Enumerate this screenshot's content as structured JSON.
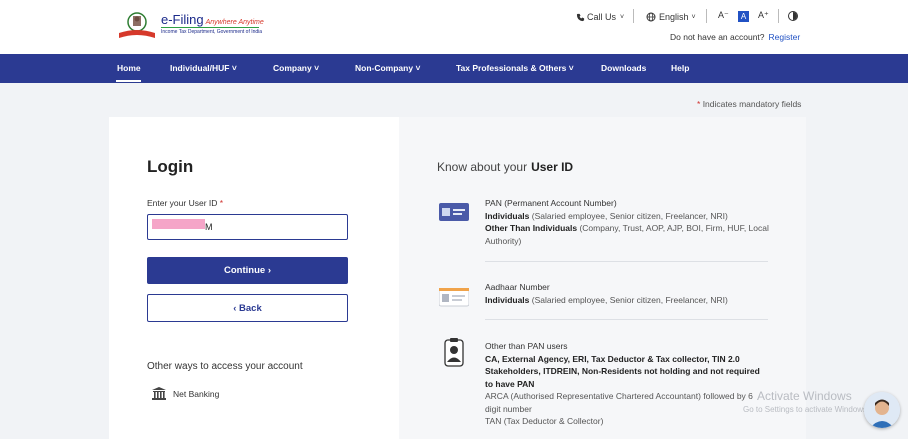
{
  "header": {
    "brand_main": "e-Filing",
    "brand_tagline": "Anywhere Anytime",
    "brand_sub": "Income Tax Department, Government of India",
    "call_us": "Call Us",
    "language": "English",
    "font_decrease": "A⁻",
    "font_normal": "A",
    "font_increase": "A⁺",
    "no_account_text": "Do not have an account?",
    "register_link": "Register"
  },
  "nav": {
    "items": [
      {
        "label": "Home"
      },
      {
        "label": "Individual/HUF ˅"
      },
      {
        "label": "Company ˅"
      },
      {
        "label": "Non-Company ˅"
      },
      {
        "label": "Tax Professionals & Others ˅"
      },
      {
        "label": "Downloads"
      },
      {
        "label": "Help"
      }
    ]
  },
  "mandatory_note": "Indicates mandatory fields",
  "mandatory_star": "*",
  "login": {
    "title": "Login",
    "user_id_label": "Enter your User ID",
    "required_star": "*",
    "user_id_value": "M",
    "continue_label": "Continue  ›",
    "back_label": "‹  Back",
    "other_ways": "Other ways to access your account",
    "net_banking": "Net Banking"
  },
  "know": {
    "title_prefix": "Know about your",
    "title_bold": "User ID",
    "items": [
      {
        "head": "PAN (Permanent Account Number)",
        "line1_bold": "Individuals",
        "line1_rest": " (Salaried employee, Senior citizen, Freelancer, NRI)",
        "line2_bold": "Other Than Individuals",
        "line2_rest": " (Company, Trust, AOP, AJP, BOI, Firm, HUF, Local Authority)"
      },
      {
        "head": "Aadhaar Number",
        "line1_bold": "Individuals",
        "line1_rest": " (Salaried employee, Senior citizen, Freelancer, NRI)"
      },
      {
        "head": "Other than PAN users",
        "line1_bold": "CA, External Agency, ERI, Tax Deductor & Tax collector, TIN 2.0 Stakeholders, ITDREIN, Non-Residents not holding and not required to have PAN",
        "line2": "ARCA (Authorised Representative Chartered Accountant) followed by 6 digit number",
        "line3": "TAN (Tax Deductor & Collector)"
      }
    ]
  },
  "os_watermark": {
    "title": "Activate Windows",
    "subtitle": "Go to Settings to activate Windows."
  },
  "icons": [
    "emblem-icon",
    "phone-icon",
    "globe-icon",
    "contrast-icon",
    "bank-icon",
    "pan-card-icon",
    "aadhaar-card-icon",
    "user-badge-icon",
    "chat-assistant-icon"
  ],
  "colors": {
    "nav_bg": "#2b3a92",
    "primary_button": "#2b3a92",
    "link": "#2152c4",
    "required": "#d0312d",
    "page_bg": "#f1f3f6"
  }
}
